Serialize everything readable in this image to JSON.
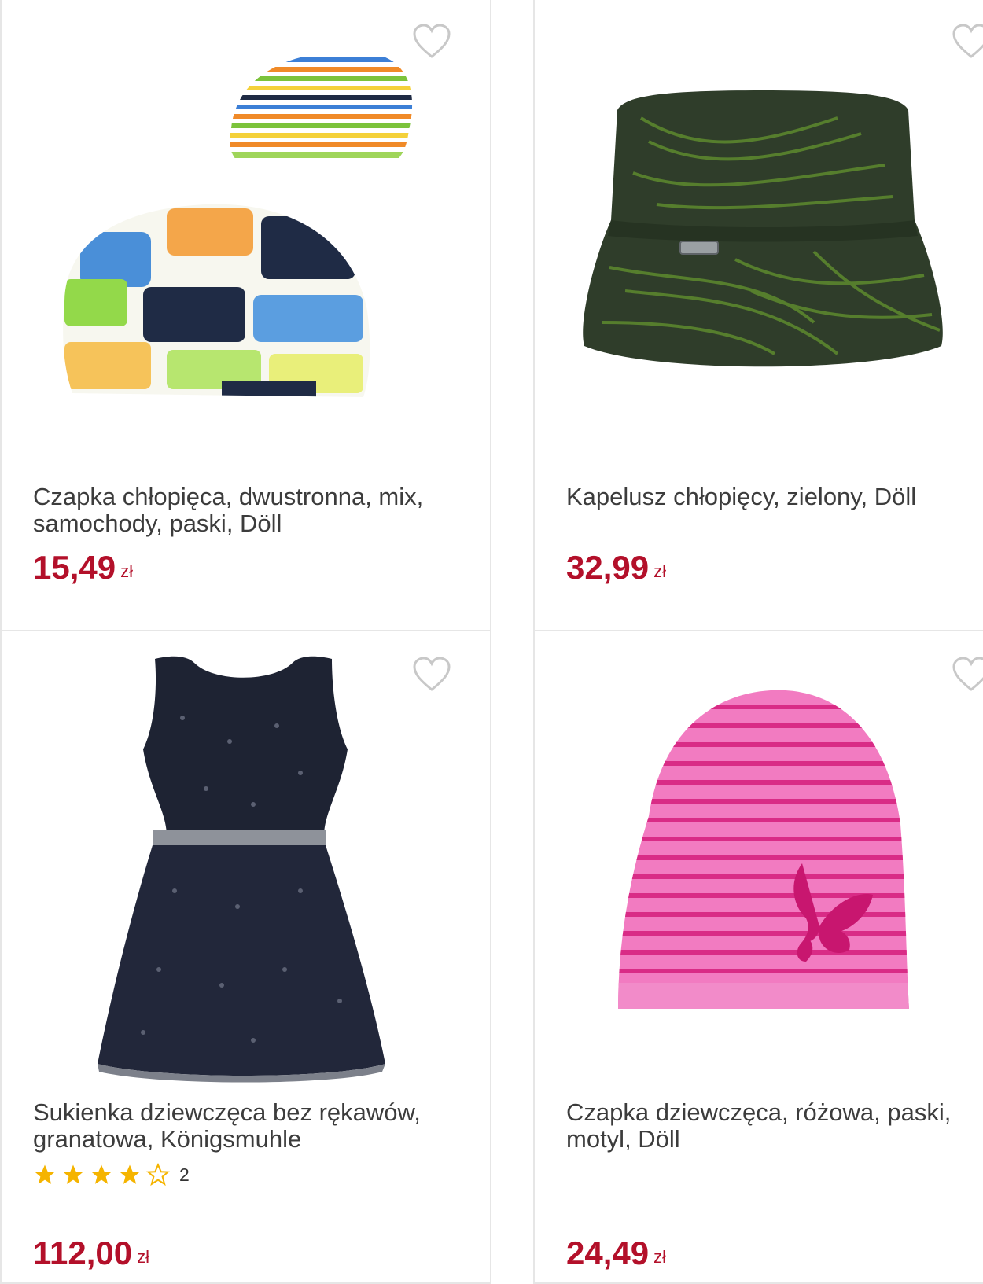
{
  "products": [
    {
      "title": "Czapka chłopięca, dwustronna, mix, samochody, paski, Döll",
      "price": "15,49",
      "currency": "zł"
    },
    {
      "title": "Kapelusz chłopięcy, zielony, Döll",
      "price": "32,99",
      "currency": "zł"
    },
    {
      "title": "Sukienka dziewczęca bez rękawów, granatowa, Königsmuhle",
      "price": "112,00",
      "currency": "zł",
      "rating": 4,
      "rating_max": 5,
      "reviews": "2"
    },
    {
      "title": "Czapka dziewczęca, różowa, paski, motyl, Döll",
      "price": "24,49",
      "currency": "zł"
    }
  ],
  "icons": {
    "favorite": "heart-outline-icon",
    "star": "star-icon"
  },
  "colors": {
    "price": "#b3102a",
    "star": "#f5b400",
    "border": "#e6e6e6"
  }
}
